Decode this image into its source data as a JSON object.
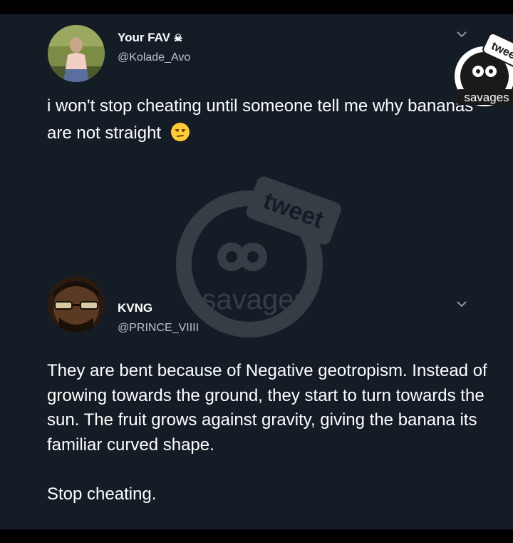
{
  "tweet1": {
    "display_name": "Your FAV",
    "name_glyph": "☠",
    "handle": "@Kolade_Avo",
    "text": "i won't stop cheating until someone tell me why bananas are not straight"
  },
  "tweet2": {
    "display_name": "KVNG",
    "handle": "@PRINCE_VIIII",
    "text": "They are bent because of Negative geotropism. Instead of growing towards the ground, they start to turn towards the sun. The fruit grows against gravity, giving the banana its familiar curved shape.\n\nStop cheating."
  },
  "watermark": {
    "top_word": "tweet",
    "bottom_word": "savages"
  },
  "badge": {
    "top_word": "twee",
    "bottom_word": "savages"
  },
  "colors": {
    "background": "#141d26",
    "text": "#ffffff",
    "secondary_text": "#b9c4cf"
  }
}
